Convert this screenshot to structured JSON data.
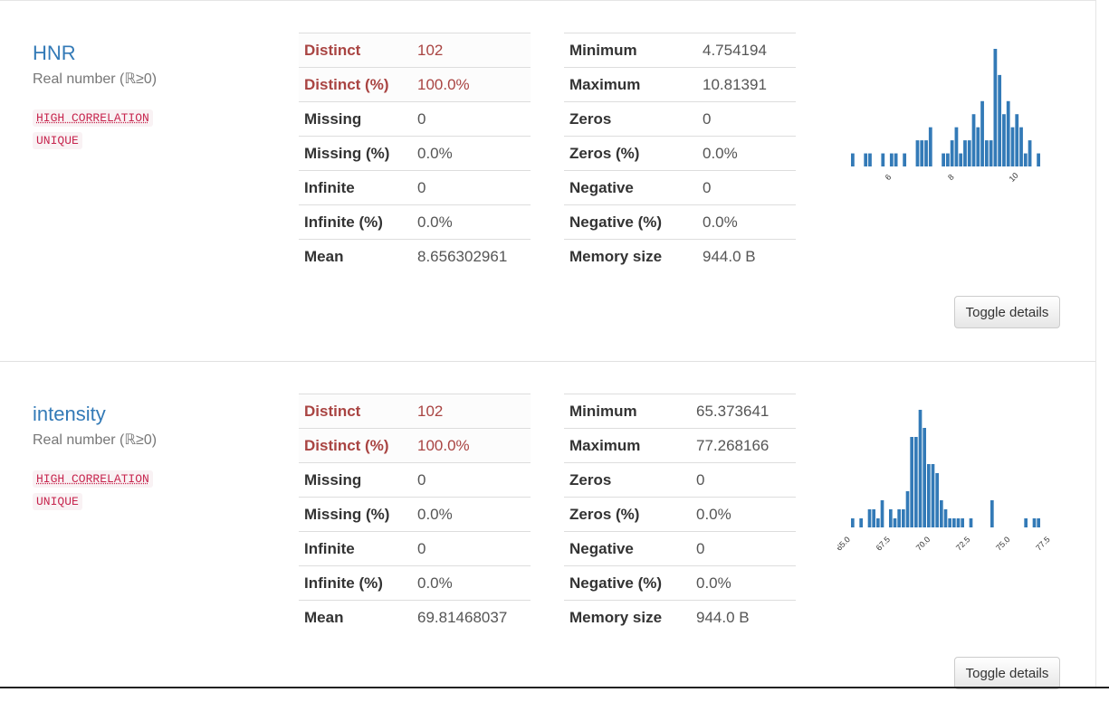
{
  "variables": [
    {
      "name": "HNR",
      "type": "Real number (ℝ≥0)",
      "badges": [
        "HIGH CORRELATION",
        "UNIQUE"
      ],
      "stats_left": [
        {
          "key": "Distinct",
          "value": "102",
          "alert": true
        },
        {
          "key": "Distinct (%)",
          "value": "100.0%",
          "alert": true
        },
        {
          "key": "Missing",
          "value": "0"
        },
        {
          "key": "Missing (%)",
          "value": "0.0%"
        },
        {
          "key": "Infinite",
          "value": "0"
        },
        {
          "key": "Infinite (%)",
          "value": "0.0%"
        },
        {
          "key": "Mean",
          "value": "8.656302961"
        }
      ],
      "stats_right": [
        {
          "key": "Minimum",
          "value": "4.754194"
        },
        {
          "key": "Maximum",
          "value": "10.81391"
        },
        {
          "key": "Zeros",
          "value": "0"
        },
        {
          "key": "Zeros (%)",
          "value": "0.0%"
        },
        {
          "key": "Negative",
          "value": "0"
        },
        {
          "key": "Negative (%)",
          "value": "0.0%"
        },
        {
          "key": "Memory size",
          "value": "944.0 B"
        }
      ],
      "toggle_label": "Toggle details"
    },
    {
      "name": "intensity",
      "type": "Real number (ℝ≥0)",
      "badges": [
        "HIGH CORRELATION",
        "UNIQUE"
      ],
      "stats_left": [
        {
          "key": "Distinct",
          "value": "102",
          "alert": true
        },
        {
          "key": "Distinct (%)",
          "value": "100.0%",
          "alert": true
        },
        {
          "key": "Missing",
          "value": "0"
        },
        {
          "key": "Missing (%)",
          "value": "0.0%"
        },
        {
          "key": "Infinite",
          "value": "0"
        },
        {
          "key": "Infinite (%)",
          "value": "0.0%"
        },
        {
          "key": "Mean",
          "value": "69.81468037"
        }
      ],
      "stats_right": [
        {
          "key": "Minimum",
          "value": "65.373641"
        },
        {
          "key": "Maximum",
          "value": "77.268166"
        },
        {
          "key": "Zeros",
          "value": "0"
        },
        {
          "key": "Zeros (%)",
          "value": "0.0%"
        },
        {
          "key": "Negative",
          "value": "0"
        },
        {
          "key": "Negative (%)",
          "value": "0.0%"
        },
        {
          "key": "Memory size",
          "value": "944.0 B"
        }
      ],
      "toggle_label": "Toggle details"
    }
  ],
  "chart_data": [
    {
      "type": "bar",
      "variable": "HNR",
      "bar_color": "#337ab7",
      "x_range": [
        4.754194,
        10.81391
      ],
      "xticks": [
        6,
        8,
        10
      ],
      "counts": [
        1,
        0,
        0,
        1,
        1,
        0,
        0,
        1,
        0,
        1,
        1,
        0,
        1,
        0,
        0,
        2,
        2,
        2,
        3,
        0,
        0,
        1,
        1,
        2,
        3,
        1,
        2,
        2,
        4,
        3,
        5,
        2,
        2,
        9,
        7,
        4,
        5,
        3,
        4,
        3,
        1,
        2,
        0,
        1
      ]
    },
    {
      "type": "bar",
      "variable": "intensity",
      "bar_color": "#337ab7",
      "x_range": [
        65.373641,
        77.268166
      ],
      "xticks": [
        "65.0",
        "67.5",
        "70.0",
        "72.5",
        "75.0",
        "77.5"
      ],
      "counts": [
        1,
        0,
        1,
        0,
        2,
        2,
        1,
        3,
        0,
        2,
        1,
        2,
        2,
        4,
        10,
        10,
        13,
        11,
        7,
        7,
        6,
        3,
        2,
        1,
        1,
        1,
        1,
        0,
        1,
        0,
        0,
        0,
        0,
        3,
        0,
        0,
        0,
        0,
        0,
        0,
        0,
        1,
        0,
        1,
        1
      ]
    }
  ]
}
